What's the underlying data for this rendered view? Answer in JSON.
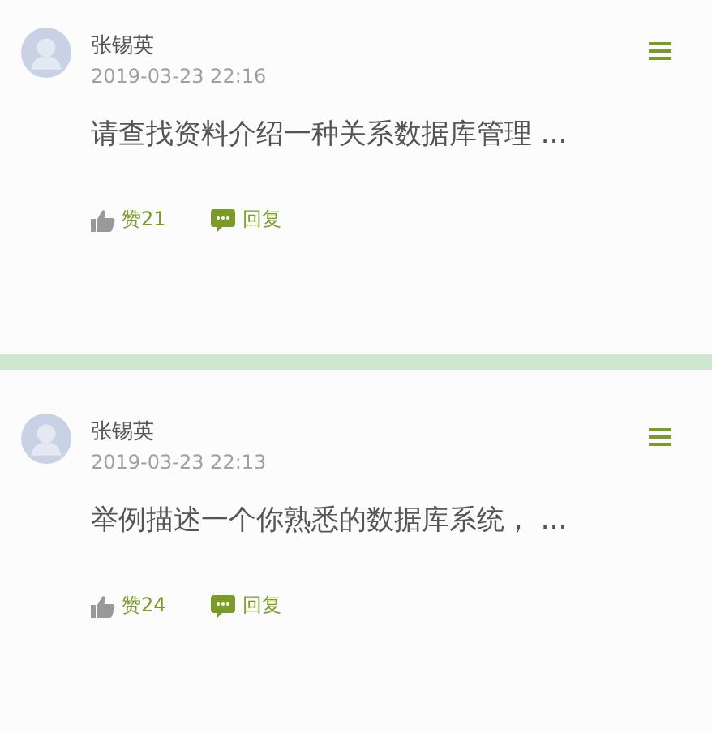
{
  "posts": [
    {
      "author": "张锡英",
      "time": "2019-03-23 22:16",
      "content": "请查找资料介绍一种关系数据库管理 ...",
      "likes": "赞21",
      "reply": "回复"
    },
    {
      "author": "张锡英",
      "time": "2019-03-23 22:13",
      "content": "举例描述一个你熟悉的数据库系统， ...",
      "likes": "赞24",
      "reply": "回复"
    }
  ]
}
